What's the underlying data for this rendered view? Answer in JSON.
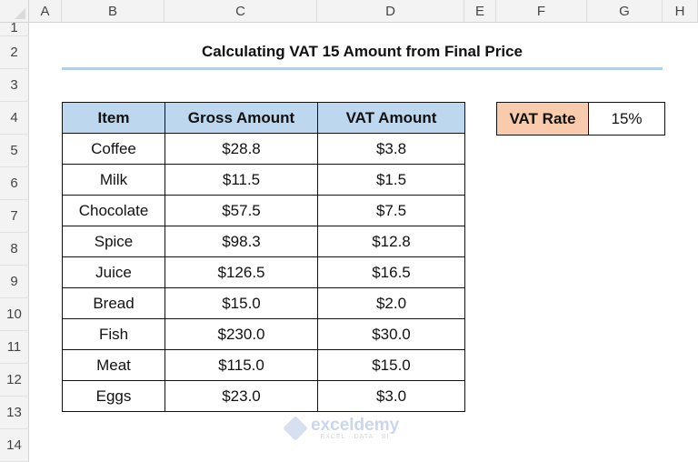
{
  "columns": [
    "A",
    "B",
    "C",
    "D",
    "E",
    "F",
    "G",
    "H"
  ],
  "rows": [
    "1",
    "2",
    "3",
    "4",
    "5",
    "6",
    "7",
    "8",
    "9",
    "10",
    "11",
    "12",
    "13",
    "14"
  ],
  "title": "Calculating VAT 15 Amount from Final Price",
  "table": {
    "headers": [
      "Item",
      "Gross Amount",
      "VAT Amount"
    ],
    "rows": [
      [
        "Coffee",
        "$28.8",
        "$3.8"
      ],
      [
        "Milk",
        "$11.5",
        "$1.5"
      ],
      [
        "Chocolate",
        "$57.5",
        "$7.5"
      ],
      [
        "Spice",
        "$98.3",
        "$12.8"
      ],
      [
        "Juice",
        "$126.5",
        "$16.5"
      ],
      [
        "Bread",
        "$15.0",
        "$2.0"
      ],
      [
        "Fish",
        "$230.0",
        "$30.0"
      ],
      [
        "Meat",
        "$115.0",
        "$15.0"
      ],
      [
        "Eggs",
        "$23.0",
        "$3.0"
      ]
    ]
  },
  "vat_rate": {
    "label": "VAT Rate",
    "value": "15%"
  },
  "watermark": {
    "name": "exceldemy",
    "tagline": "EXCEL · DATA · BI"
  },
  "colors": {
    "header_fill": "#bdd7ee",
    "rate_label_fill": "#f8cbad",
    "title_underline": "#b4cfec"
  }
}
